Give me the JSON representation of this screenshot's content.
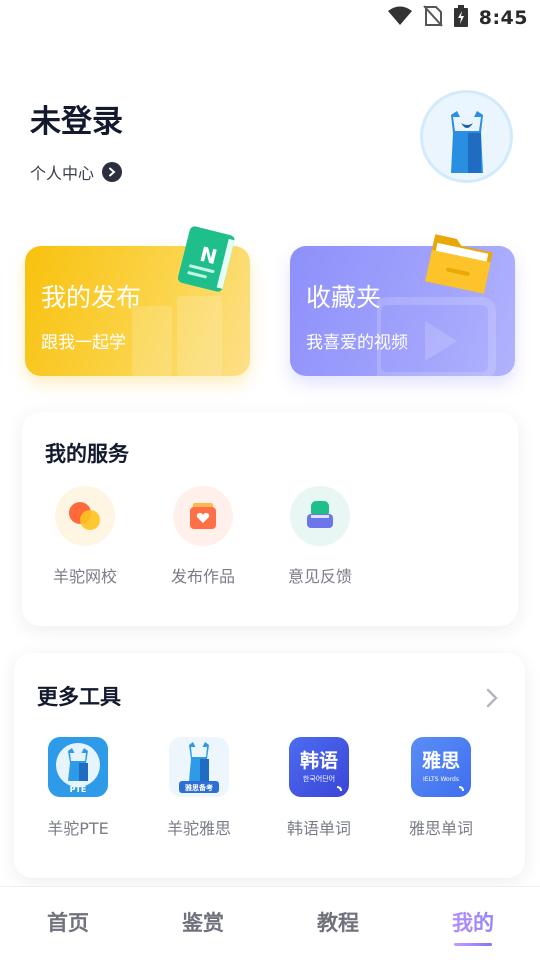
{
  "status_bar": {
    "time": "8:45"
  },
  "profile": {
    "name": "未登录",
    "center_link": "个人中心"
  },
  "cards": {
    "publish": {
      "title": "我的发布",
      "subtitle": "跟我一起学",
      "icon_letter": "N"
    },
    "favorite": {
      "title": "收藏夹",
      "subtitle": "我喜爱的视频"
    }
  },
  "services": {
    "title": "我的服务",
    "items": [
      {
        "label": "羊驼网校",
        "icon": "school-icon"
      },
      {
        "label": "发布作品",
        "icon": "publish-work-icon"
      },
      {
        "label": "意见反馈",
        "icon": "feedback-icon"
      }
    ]
  },
  "tools": {
    "title": "更多工具",
    "items": [
      {
        "label": "羊驼PTE",
        "icon": "alpaca-pte-icon",
        "badge": "PTE"
      },
      {
        "label": "羊驼雅思",
        "icon": "alpaca-ielts-icon",
        "badge": "雅思备考"
      },
      {
        "label": "韩语单词",
        "icon": "korean-words-icon",
        "main": "韩语",
        "sub": "한국어단어"
      },
      {
        "label": "雅思单词",
        "icon": "ielts-words-icon",
        "main": "雅思",
        "sub": "IELTS Words"
      }
    ]
  },
  "bottom_nav": {
    "items": [
      {
        "label": "首页"
      },
      {
        "label": "鉴赏"
      },
      {
        "label": "教程"
      },
      {
        "label": "我的"
      }
    ],
    "active_index": 3
  },
  "colors": {
    "publish_card": "#f8c10d",
    "favorite_card": "#8e90fb",
    "nav_active_start": "#c79aff",
    "nav_active_end": "#7c78f5"
  }
}
